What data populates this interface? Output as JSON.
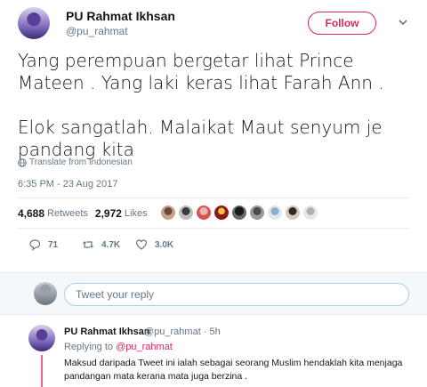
{
  "tweet": {
    "author_name": "PU Rahmat Ikhsan",
    "author_handle": "@pu_rahmat",
    "follow_label": "Follow",
    "line1": "Yang perempuan bergetar lihat Prince",
    "line2": "Mateen . Yang laki keras lihat Farah Ann .",
    "line3": "Elok sangatlah. Malaikat Maut senyum je",
    "line4": "pandang kita",
    "translate_label": "Translate from Indonesian",
    "timestamp": "6:35 PM - 23 Aug 2017",
    "retweets_count": "4,688",
    "retweets_label": "Retweets",
    "likes_count": "2,972",
    "likes_label": "Likes",
    "reply_count": "71",
    "retweet_action_count": "4.7K",
    "like_action_count": "3.0K"
  },
  "reply_box": {
    "placeholder": "Tweet your reply"
  },
  "reply": {
    "author_name": "PU Rahmat Ikhsan",
    "meta": "@pu_rahmat · 5h",
    "replying_prefix": "Replying to",
    "replying_handle": "@pu_rahmat",
    "text_line1": "Maksud daripada Tweet ini ialah sebagai seorang Muslim hendaklah kita menjaga",
    "text_line2": "pandangan mata kerana mata juga berzina ."
  },
  "colors": {
    "accent": "#e0245e",
    "muted": "#657786",
    "text": "#14171a"
  },
  "icons": {
    "follow_chevron": "chevron-down-icon",
    "translate": "globe-icon",
    "reply": "reply-icon",
    "retweet": "retweet-icon",
    "like": "heart-icon"
  }
}
